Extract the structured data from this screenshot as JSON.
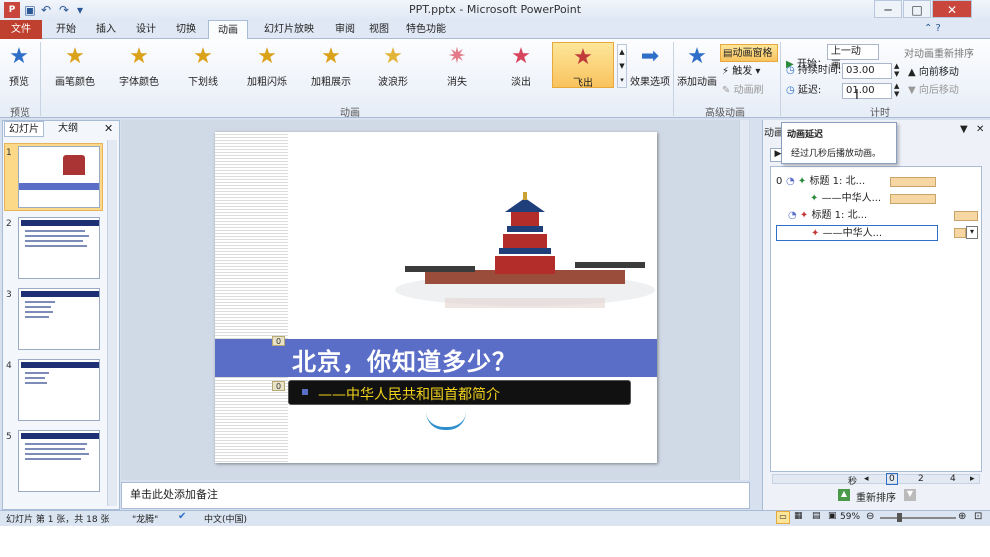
{
  "window": {
    "title": "PPT.pptx - Microsoft PowerPoint"
  },
  "tabs": [
    "文件",
    "开始",
    "插入",
    "设计",
    "切换",
    "动画",
    "幻灯片放映",
    "审阅",
    "视图",
    "特色功能"
  ],
  "ribbon": {
    "preview_label": "预览",
    "preview_group": "预览",
    "effects": [
      "画笔颜色",
      "字体颜色",
      "下划线",
      "加粗闪烁",
      "加粗展示",
      "波浪形",
      "消失",
      "淡出",
      "飞出"
    ],
    "effect_options": "效果选项",
    "anim_group": "动画",
    "add_anim": "添加动画",
    "anim_pane": "动画窗格",
    "trigger": "触发",
    "anim_painter": "动画刷",
    "adv_group": "高级动画",
    "start_label": "开始：",
    "start_value": "上一动画...",
    "duration_label": "持续时间:",
    "duration_value": "03.00",
    "delay_label": "延迟:",
    "delay_value": "01.00",
    "reorder_label": "对动画重新排序",
    "move_earlier": "向前移动",
    "move_later": "向后移动",
    "timing_group": "计时"
  },
  "tooltip": {
    "title": "动画延迟",
    "body": "经过几秒后播放动画。"
  },
  "leftpane": {
    "tab_slides": "幻灯片",
    "tab_outline": "大纲",
    "slide_nums": [
      "1",
      "2",
      "3",
      "4",
      "5"
    ]
  },
  "slide": {
    "title": "北京，你知道多少？",
    "subtitle": "——中华人民共和国首都简介",
    "tag1": "0",
    "tag2": "0"
  },
  "notes": {
    "placeholder": "单击此处添加备注"
  },
  "animpane": {
    "title": "动画",
    "items": [
      {
        "num": "0",
        "label": "标题 1: 北..."
      },
      {
        "num": "",
        "label": "——中华人..."
      },
      {
        "num": "",
        "label": "标题 1: 北..."
      },
      {
        "num": "",
        "label": "——中华人..."
      }
    ],
    "timeline": {
      "unit": "秒",
      "ticks": [
        "0",
        "2",
        "4"
      ]
    },
    "reorder": "重新排序"
  },
  "status": {
    "slide_info": "幻灯片 第 1 张，共 18 张",
    "theme": "\"龙腾\"",
    "lang": "中文(中国)",
    "zoom": "59%"
  }
}
